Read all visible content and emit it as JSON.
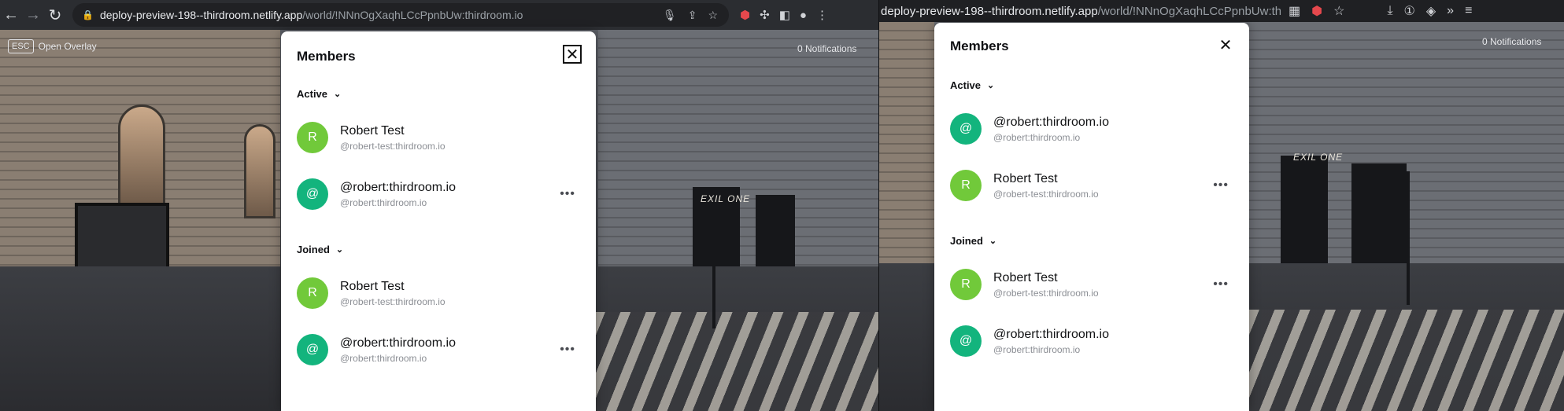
{
  "colors": {
    "avatar_green": "#71c93a",
    "avatar_teal": "#13b47d"
  },
  "left": {
    "browser": {
      "url_host": "deploy-preview-198--thirdroom.netlify.app",
      "url_path": "/world/!NNnOgXaqhLCcPpnbUw:thirdroom.io",
      "icons": [
        "back-icon",
        "forward-icon",
        "reload-icon",
        "lock-icon",
        "mic-icon",
        "share-icon",
        "star-icon",
        "extension-icon",
        "profile-icon",
        "menu-icon"
      ]
    },
    "overlay": {
      "key": "ESC",
      "label": "Open Overlay"
    },
    "notifications": "0 Notifications",
    "panel": {
      "title": "Members",
      "sections": [
        {
          "label": "Active",
          "members": [
            {
              "initial": "R",
              "name": "Robert Test",
              "id": "@robert-test:thirdroom.io",
              "color": "#71c93a",
              "more": ""
            },
            {
              "initial": "@",
              "name": "@robert:thirdroom.io",
              "id": "@robert:thirdroom.io",
              "color": "#13b47d",
              "more": "•••"
            }
          ]
        },
        {
          "label": "Joined",
          "members": [
            {
              "initial": "R",
              "name": "Robert Test",
              "id": "@robert-test:thirdroom.io",
              "color": "#71c93a",
              "more": ""
            },
            {
              "initial": "@",
              "name": "@robert:thirdroom.io",
              "id": "@robert:thirdroom.io",
              "color": "#13b47d",
              "more": "•••"
            }
          ]
        }
      ]
    },
    "street_sign": "EXIL ONE"
  },
  "right": {
    "browser": {
      "url_host": "deploy-preview-198--thirdroom.netlify.app",
      "url_path": "/world/!NNnOgXaqhLCcPpnbUw:thi"
    },
    "notifications": "0 Notifications",
    "panel": {
      "title": "Members",
      "sections": [
        {
          "label": "Active",
          "members": [
            {
              "initial": "@",
              "name": "@robert:thirdroom.io",
              "id": "@robert:thirdroom.io",
              "color": "#13b47d",
              "more": ""
            },
            {
              "initial": "R",
              "name": "Robert Test",
              "id": "@robert-test:thirdroom.io",
              "color": "#71c93a",
              "more": "•••"
            }
          ]
        },
        {
          "label": "Joined",
          "members": [
            {
              "initial": "R",
              "name": "Robert Test",
              "id": "@robert-test:thirdroom.io",
              "color": "#71c93a",
              "more": "•••"
            },
            {
              "initial": "@",
              "name": "@robert:thirdroom.io",
              "id": "@robert:thirdroom.io",
              "color": "#13b47d",
              "more": ""
            }
          ]
        }
      ]
    },
    "street_sign": "EXIL ONE"
  }
}
